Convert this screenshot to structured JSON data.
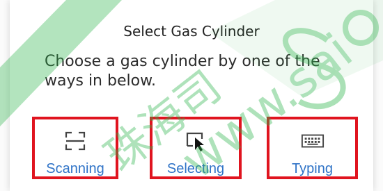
{
  "dialog": {
    "title": "Select Gas Cylinder",
    "description": "Choose a gas cylinder by one of the ways in below."
  },
  "options": [
    {
      "label": "Scanning",
      "icon": "scan-icon"
    },
    {
      "label": "Selecting",
      "icon": "cursor-selection-icon"
    },
    {
      "label": "Typing",
      "icon": "keyboard-icon"
    }
  ],
  "colors": {
    "highlight": "#e0141f",
    "label": "#2f73c7",
    "watermark_green": "#2bb34a"
  },
  "watermark": {
    "text_cn": "珠海司",
    "text_url": "www.sai"
  }
}
